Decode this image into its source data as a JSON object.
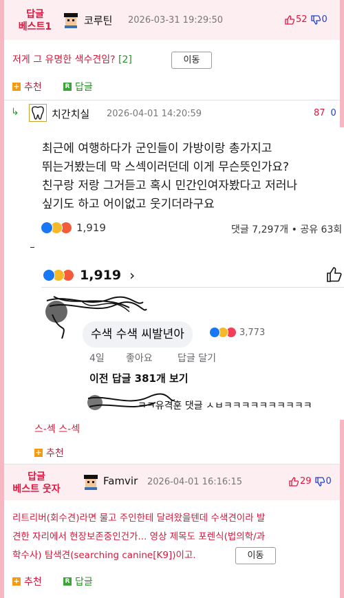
{
  "best1": {
    "label_line1": "답글",
    "label_line2": "베스트1",
    "nick": "코루틴",
    "date": "2026-03-31 19:29:50",
    "up": "52",
    "down": "0",
    "text": "저게 그 유명한 색수견임?",
    "count": "[2]",
    "move": "이동",
    "recommend": "추천",
    "reply": "답글"
  },
  "reply_comment": {
    "arrow": "↳",
    "nick": "치간치실",
    "date": "2026-04-01 14:20:59",
    "up": "87",
    "down": "0",
    "post_lines": [
      "최근에 여행하다가 군인들이 가방이랑 총가지고",
      "뛰는거봤는데 막 스섹이러던데 이게 무슨뜻인가요?",
      "친구랑 저랑 그거듣고 혹시 민간인여자봤다고 저러나",
      "싶기도 하고 어이없고 웃기더라구요"
    ],
    "reaction_count": "1,919",
    "share_text": "댓글 7,297개 • 공유 63회",
    "fb_reaction_count": "1,919",
    "fb_comment": "수색 수색 씨발년아",
    "fb_comment_reactions": "3,773",
    "fb_time": "4일",
    "fb_like": "좋아요",
    "fb_reply": "답글 달기",
    "fb_prev": "이전 답글 381개 보기",
    "fb_next_snippet": "ㅋㅋ유격훈 댓글 ㅅㅂㅋㅋㅋㅋㅋㅋㅋㅋㅋㅋ",
    "text": "스-섹 스-섹",
    "recommend": "추천"
  },
  "best2": {
    "label_line1": "답글",
    "label_line2": "베스트 웃자",
    "nick": "Famvir",
    "date": "2026-04-01 16:16:15",
    "up": "29",
    "down": "0",
    "text_line1": "리트리버(회수견)라면 물고 주인한테 달려왔을텐데 수색견이라 발",
    "text_line2": "견한 자리에서 현장보존중인건가... 영상 제목도 포렌식(법의학/과",
    "text_line3": "학수사) 탐색견(searching canine[K9])이고.",
    "move": "이동",
    "recommend": "추천",
    "reply": "답글"
  },
  "colors": {
    "frame": "#f6b7c2",
    "best_bg": "#fdeef2",
    "accent_red": "#e0163e",
    "accent_blue": "#1e3cd6",
    "reply_green": "#2a8f2a",
    "plus_orange": "#f29a12"
  }
}
